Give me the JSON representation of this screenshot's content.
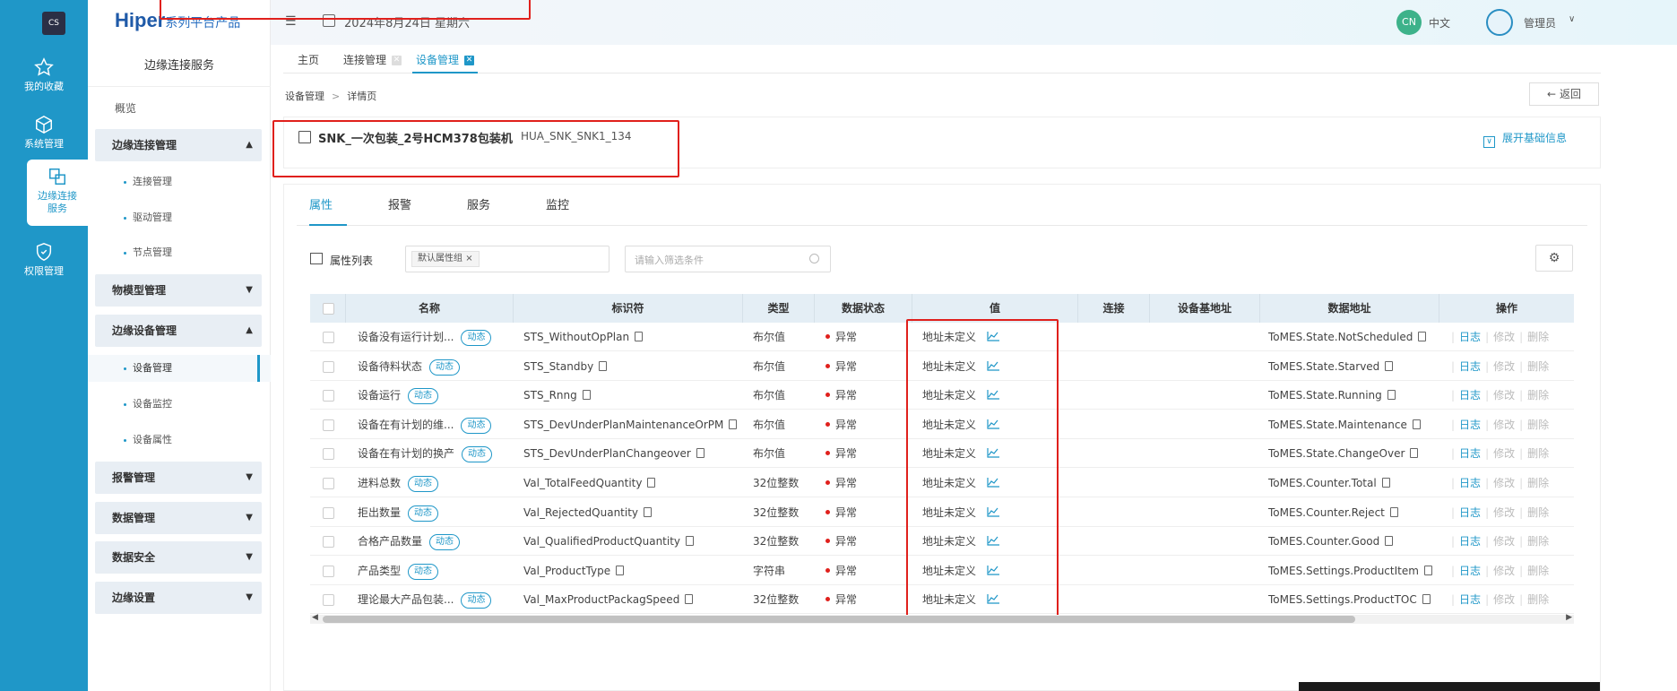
{
  "rail": {
    "logo": "CS",
    "items": [
      {
        "label": "我的收藏",
        "icon": "star-icon"
      },
      {
        "label": "系统管理",
        "icon": "cube-icon"
      },
      {
        "label": "边缘连接服务",
        "icon": "connect-icon"
      },
      {
        "label": "权限管理",
        "icon": "shield-icon"
      }
    ]
  },
  "brand": {
    "main": "Hiper",
    "sub": "系列平台产品"
  },
  "submenu": {
    "title": "边缘连接服务",
    "overview": "概览",
    "groups": [
      {
        "label": "边缘连接管理",
        "expanded": true,
        "items": [
          "连接管理",
          "驱动管理",
          "节点管理"
        ]
      },
      {
        "label": "物模型管理",
        "expanded": false
      },
      {
        "label": "边缘设备管理",
        "expanded": true,
        "items": [
          "设备管理",
          "设备监控",
          "设备属性"
        ],
        "active_item": "设备管理"
      },
      {
        "label": "报警管理",
        "expanded": false
      },
      {
        "label": "数据管理",
        "expanded": false
      },
      {
        "label": "数据安全",
        "expanded": false
      },
      {
        "label": "边缘设置",
        "expanded": false
      }
    ]
  },
  "header": {
    "date": "2024年8月24日 星期六",
    "lang_badge": "CN",
    "lang_label": "中文",
    "user": "管理员"
  },
  "tabs": [
    {
      "label": "主页",
      "closable": false
    },
    {
      "label": "连接管理",
      "closable": true
    },
    {
      "label": "设备管理",
      "closable": true,
      "active": true
    }
  ],
  "breadcrumb": {
    "parent": "设备管理",
    "sep": ">",
    "current": "详情页"
  },
  "back_label": "返回",
  "device": {
    "name": "SNK_一次包装_2号HCM378包装机",
    "code": "HUA_SNK_SNK1_134",
    "expand_label": "展开基础信息"
  },
  "subtabs": [
    "属性",
    "报警",
    "服务",
    "监控"
  ],
  "attr_list": {
    "title": "属性列表",
    "group_tag": "默认属性组",
    "filter_placeholder": "请输入筛选条件"
  },
  "table": {
    "columns": [
      "名称",
      "标识符",
      "类型",
      "数据状态",
      "值",
      "连接",
      "设备基地址",
      "数据地址",
      "操作"
    ],
    "dyn_label": "动态",
    "ops": {
      "log": "日志",
      "edit": "修改",
      "delete": "删除"
    },
    "rows": [
      {
        "name": "设备没有运行计划...",
        "id": "STS_WithoutOpPlan",
        "type": "布尔值",
        "status": "异常",
        "value": "地址未定义",
        "address": "ToMES.State.NotScheduled"
      },
      {
        "name": "设备待料状态",
        "id": "STS_Standby",
        "type": "布尔值",
        "status": "异常",
        "value": "地址未定义",
        "address": "ToMES.State.Starved"
      },
      {
        "name": "设备运行",
        "id": "STS_Rnng",
        "type": "布尔值",
        "status": "异常",
        "value": "地址未定义",
        "address": "ToMES.State.Running"
      },
      {
        "name": "设备在有计划的维...",
        "id": "STS_DevUnderPlanMaintenanceOrPM",
        "type": "布尔值",
        "status": "异常",
        "value": "地址未定义",
        "address": "ToMES.State.Maintenance"
      },
      {
        "name": "设备在有计划的换产",
        "id": "STS_DevUnderPlanChangeover",
        "type": "布尔值",
        "status": "异常",
        "value": "地址未定义",
        "address": "ToMES.State.ChangeOver"
      },
      {
        "name": "进料总数",
        "id": "Val_TotalFeedQuantity",
        "type": "32位整数",
        "status": "异常",
        "value": "地址未定义",
        "address": "ToMES.Counter.Total"
      },
      {
        "name": "拒出数量",
        "id": "Val_RejectedQuantity",
        "type": "32位整数",
        "status": "异常",
        "value": "地址未定义",
        "address": "ToMES.Counter.Reject"
      },
      {
        "name": "合格产品数量",
        "id": "Val_QualifiedProductQuantity",
        "type": "32位整数",
        "status": "异常",
        "value": "地址未定义",
        "address": "ToMES.Counter.Good"
      },
      {
        "name": "产品类型",
        "id": "Val_ProductType",
        "type": "字符串",
        "status": "异常",
        "value": "地址未定义",
        "address": "ToMES.Settings.ProductItem"
      },
      {
        "name": "理论最大产品包装...",
        "id": "Val_MaxProductPackagSpeed",
        "type": "32位整数",
        "status": "异常",
        "value": "地址未定义",
        "address": "ToMES.Settings.ProductTOC"
      }
    ]
  },
  "colors": {
    "accent": "#1f97c8",
    "rail": "#1f97c8",
    "error": "#e0201c",
    "highlight": "#e0201c"
  }
}
